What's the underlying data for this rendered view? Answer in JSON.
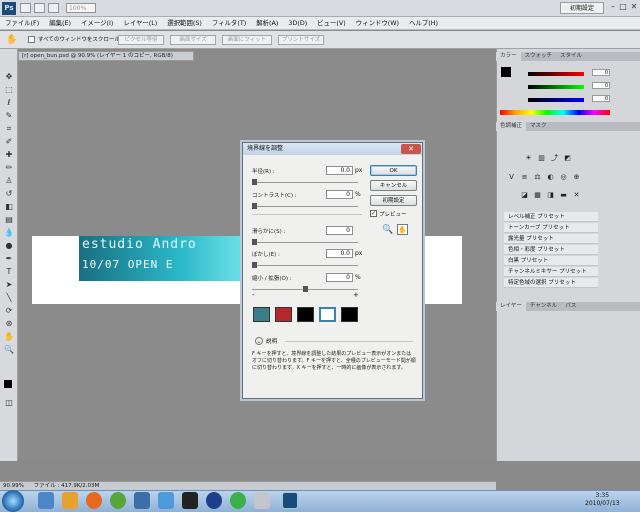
{
  "app": {
    "logo": "Ps",
    "zoom": "100%",
    "workspace": "初期設定"
  },
  "menu": [
    "ファイル(F)",
    "編集(E)",
    "イメージ(I)",
    "レイヤー(L)",
    "選択範囲(S)",
    "フィルタ(T)",
    "解析(A)",
    "3D(D)",
    "ビュー(V)",
    "ウィンドウ(W)",
    "ヘルプ(H)"
  ],
  "options": {
    "scroll_all": "すべてのウィンドウをスクロール",
    "actual_pixels": "ピクセル等倍",
    "fit_screen": "画面サイズ",
    "fill_screen": "画面にフィット",
    "print_size": "プリントサイズ"
  },
  "document": {
    "tab": "[r] open_bun.psd @ 90.9% (レイヤー 1 のコピー, RGB/8)",
    "title_text": "estudio Andro",
    "subtitle_text": "10/07 OPEN  E"
  },
  "status": {
    "zoom": "90.99%",
    "file": "ファイル : 417.9K/2.03M"
  },
  "dialog": {
    "title": "境界線を調整",
    "fields": [
      {
        "label": "半径(R) :",
        "value": "0.0",
        "unit": "px"
      },
      {
        "label": "コントラスト(C) :",
        "value": "0",
        "unit": "%"
      },
      {
        "label": "滑らかに(S) :",
        "value": "0",
        "unit": ""
      },
      {
        "label": "ぼかし(E) :",
        "value": "0.0",
        "unit": "px"
      },
      {
        "label": "縮小 / 拡張(O) :",
        "value": "0",
        "unit": "%"
      }
    ],
    "minus": "-",
    "plus": "+",
    "ok": "OK",
    "cancel": "キャンセル",
    "default": "初期設定",
    "preview": "プレビュー",
    "desc_label": "説明",
    "description": "F キーを押すと、境界線を調整した結果のプレビュー表示がオンまたはオフに切り替わります。F キーを押すと、全種のプレビューモード間が順に切り替わります。X キーを押すと、一時的に画像が表示されます。"
  },
  "panels": {
    "color_tabs": [
      "カラー",
      "スウォッチ",
      "スタイル"
    ],
    "adj_tabs": [
      "色調補正",
      "マスク"
    ],
    "layer_tabs": [
      "レイヤー",
      "チャンネル",
      "パス"
    ],
    "slider_values": [
      "0",
      "0",
      "0"
    ],
    "presets": [
      "レベル補正 プリセット",
      "トーンカーブ プリセット",
      "露光量 プリセット",
      "色相・彩度 プリセット",
      "白黒 プリセット",
      "チャンネルミキサー プリセット",
      "特定色域の選択 プリセット"
    ]
  },
  "taskbar": {
    "time": "3:35",
    "date": "2010/07/13"
  }
}
